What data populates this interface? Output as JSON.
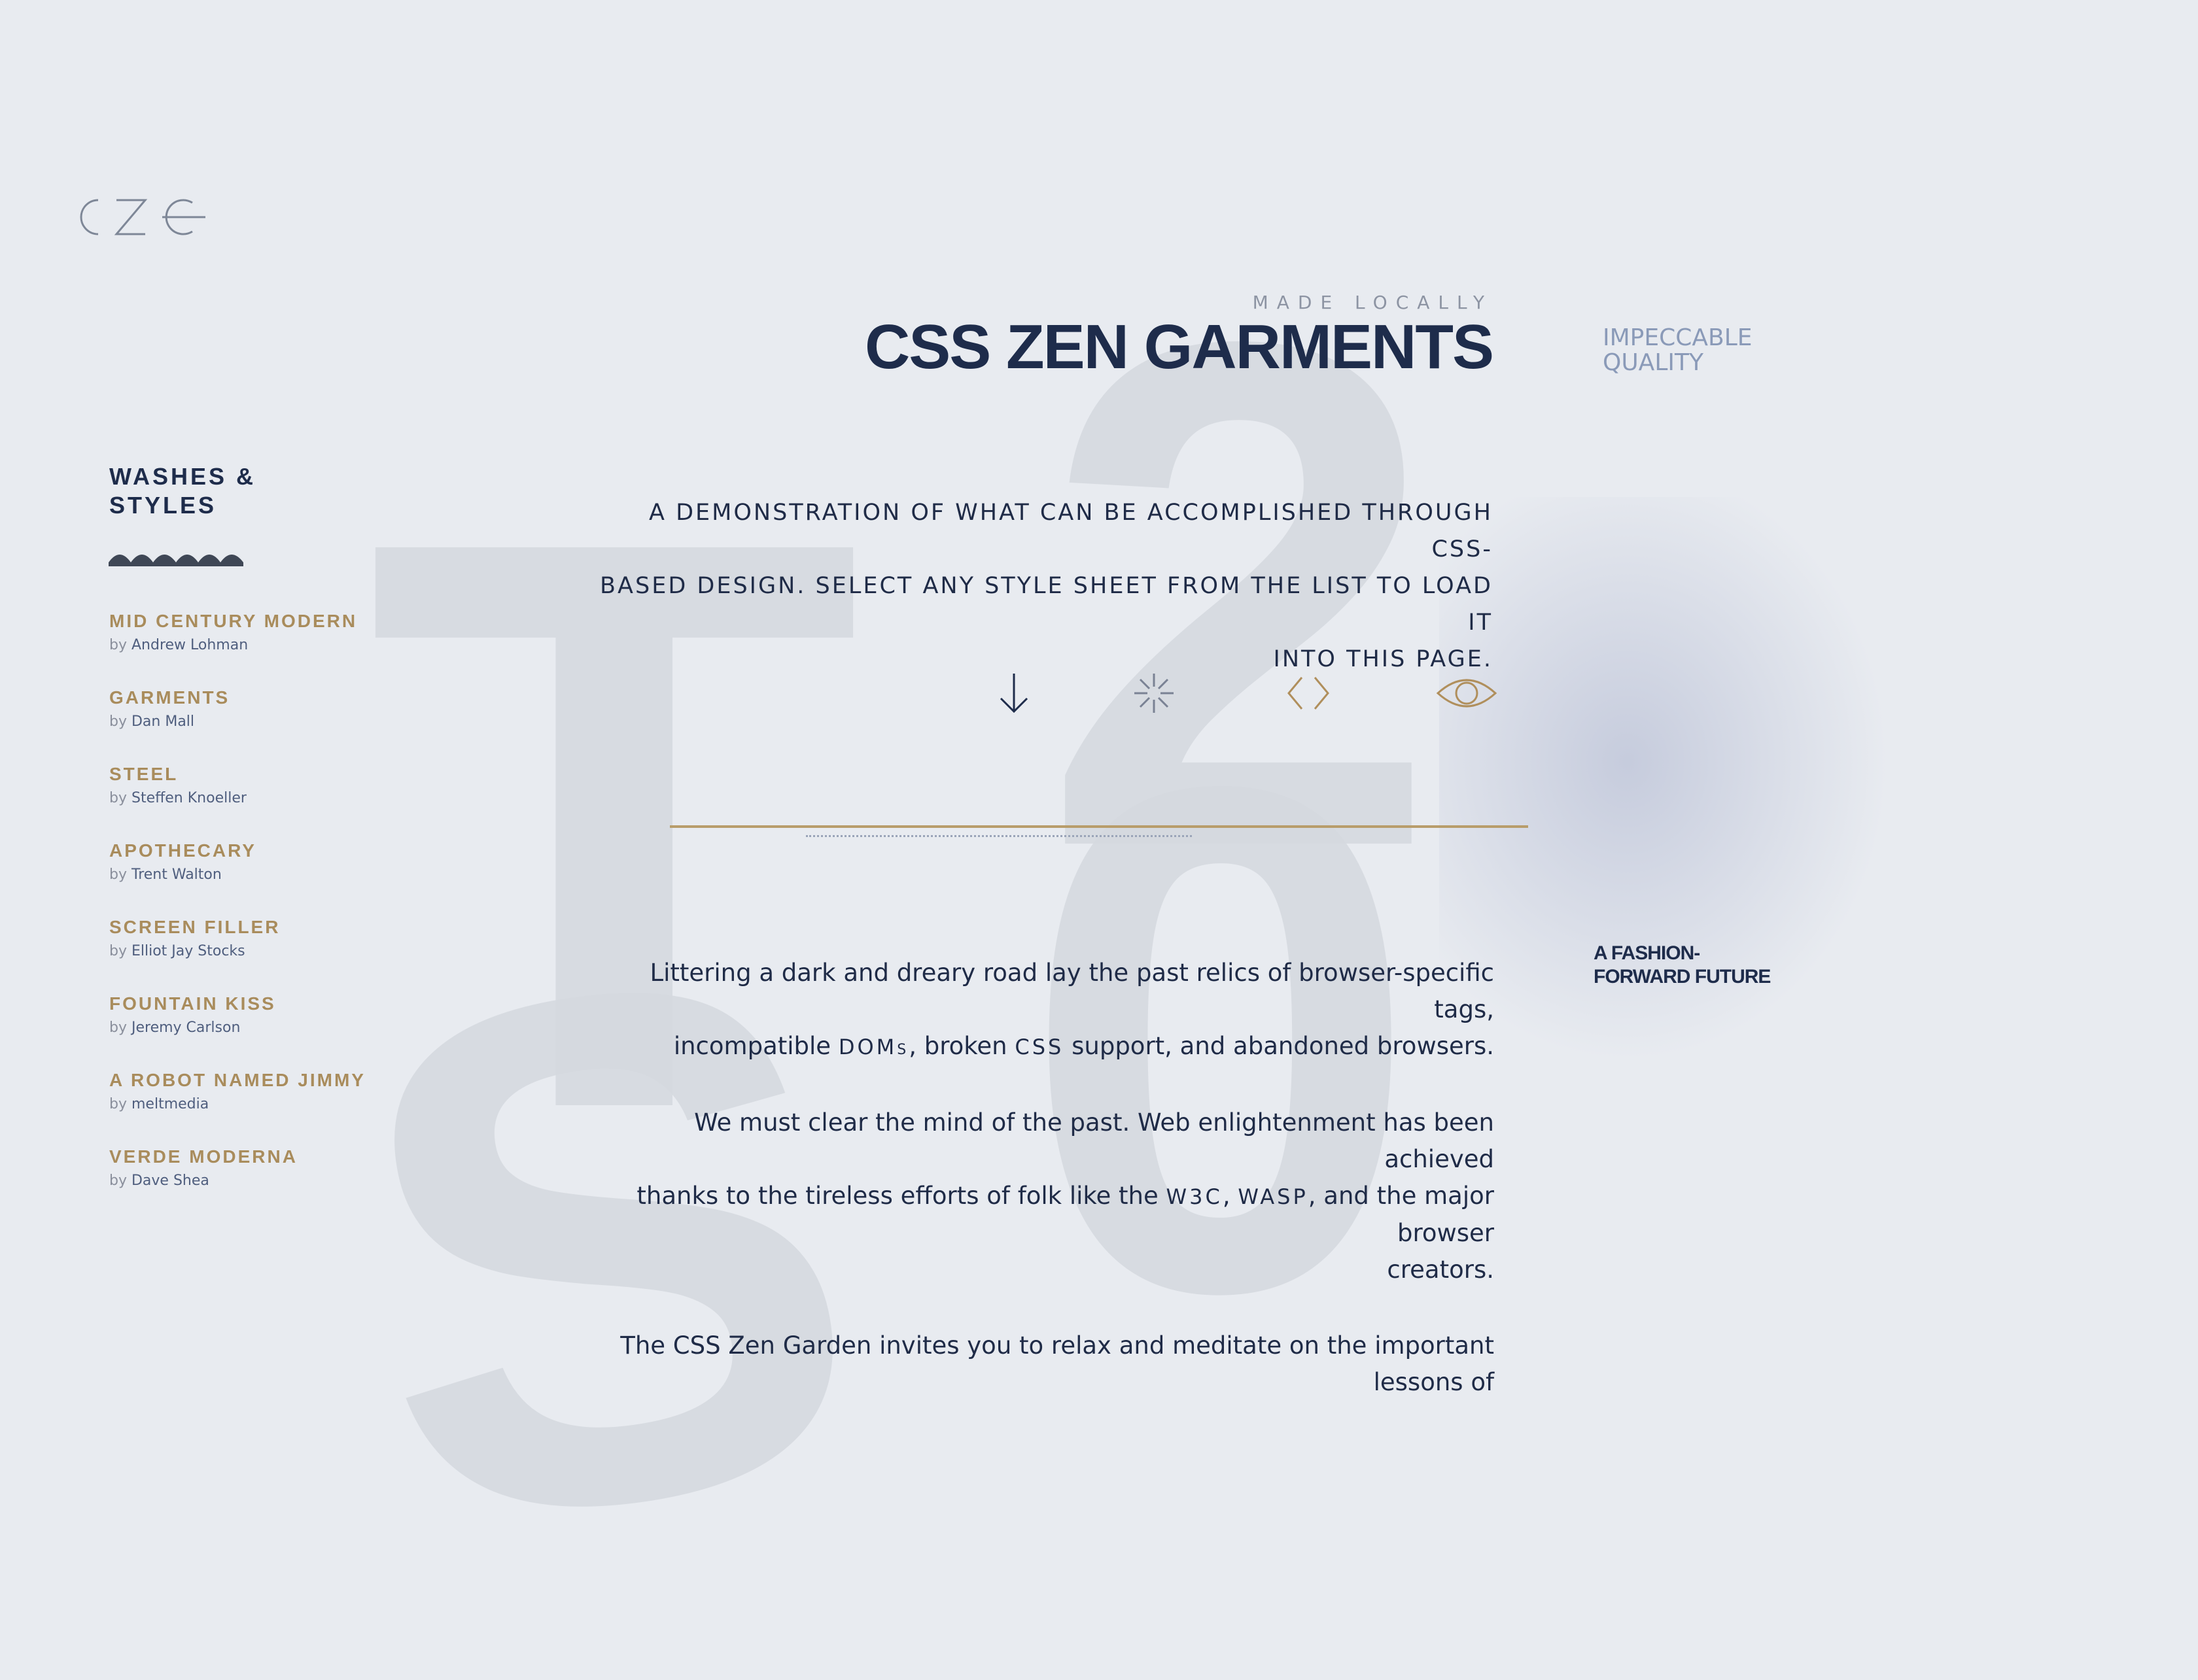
{
  "logo": {
    "text": "CZG"
  },
  "background_letters": {
    "l1": "T",
    "l2": "2",
    "l3": "S",
    "l4": "0"
  },
  "header": {
    "eyebrow": "MADE LOCALLY",
    "title": "CSS ZEN GARMENTS",
    "tagline_line1": "IMPECCABLE",
    "tagline_line2": "QUALITY"
  },
  "sidebar": {
    "title_line1": "WASHES &",
    "title_line2": "STYLES",
    "by_prefix": "by",
    "items": [
      {
        "name": "MID CENTURY MODERN",
        "author": "Andrew Lohman"
      },
      {
        "name": "GARMENTS",
        "author": "Dan Mall"
      },
      {
        "name": "STEEL",
        "author": "Steffen Knoeller"
      },
      {
        "name": "APOTHECARY",
        "author": "Trent Walton"
      },
      {
        "name": "SCREEN FILLER",
        "author": "Elliot Jay Stocks"
      },
      {
        "name": "FOUNTAIN KISS",
        "author": "Jeremy Carlson"
      },
      {
        "name": "A ROBOT NAMED JIMMY",
        "author": "meltmedia"
      },
      {
        "name": "VERDE MODERNA",
        "author": "Dave Shea"
      }
    ]
  },
  "intro": {
    "line1": "A DEMONSTRATION OF WHAT CAN BE ACCOMPLISHED THROUGH CSS-",
    "line2": "BASED DESIGN. SELECT ANY STYLE SHEET FROM THE LIST TO LOAD IT",
    "line3": "INTO THIS PAGE."
  },
  "icons": [
    "arrow-down-icon",
    "sparkle-icon",
    "code-icon",
    "eye-icon"
  ],
  "side_note": {
    "line1": "A FASHION-",
    "line2": "FORWARD FUTURE"
  },
  "body": {
    "p1_a": "Littering a dark and dreary road lay the past relics of browser-specific tags,",
    "p1_b": "incompatible ",
    "p1_doms": "DOMs",
    "p1_c": ", broken ",
    "p1_css": "CSS",
    "p1_d": " support, and abandoned browsers.",
    "p2_a": "We must clear the mind of the past. Web enlightenment has been achieved",
    "p2_b": "thanks to the tireless efforts of folk like the ",
    "p2_w3c": "W3C",
    "p2_comma": ", ",
    "p2_wasp": "WASP",
    "p2_c": ", and the major browser",
    "p2_d": "creators.",
    "p3_a": "The CSS Zen Garden invites you to relax and meditate on the important lessons of"
  },
  "colors": {
    "background": "#e8ebf0",
    "navy": "#1e2c4b",
    "gold": "#a98c5c",
    "muted_blue": "#8a9ab8"
  }
}
